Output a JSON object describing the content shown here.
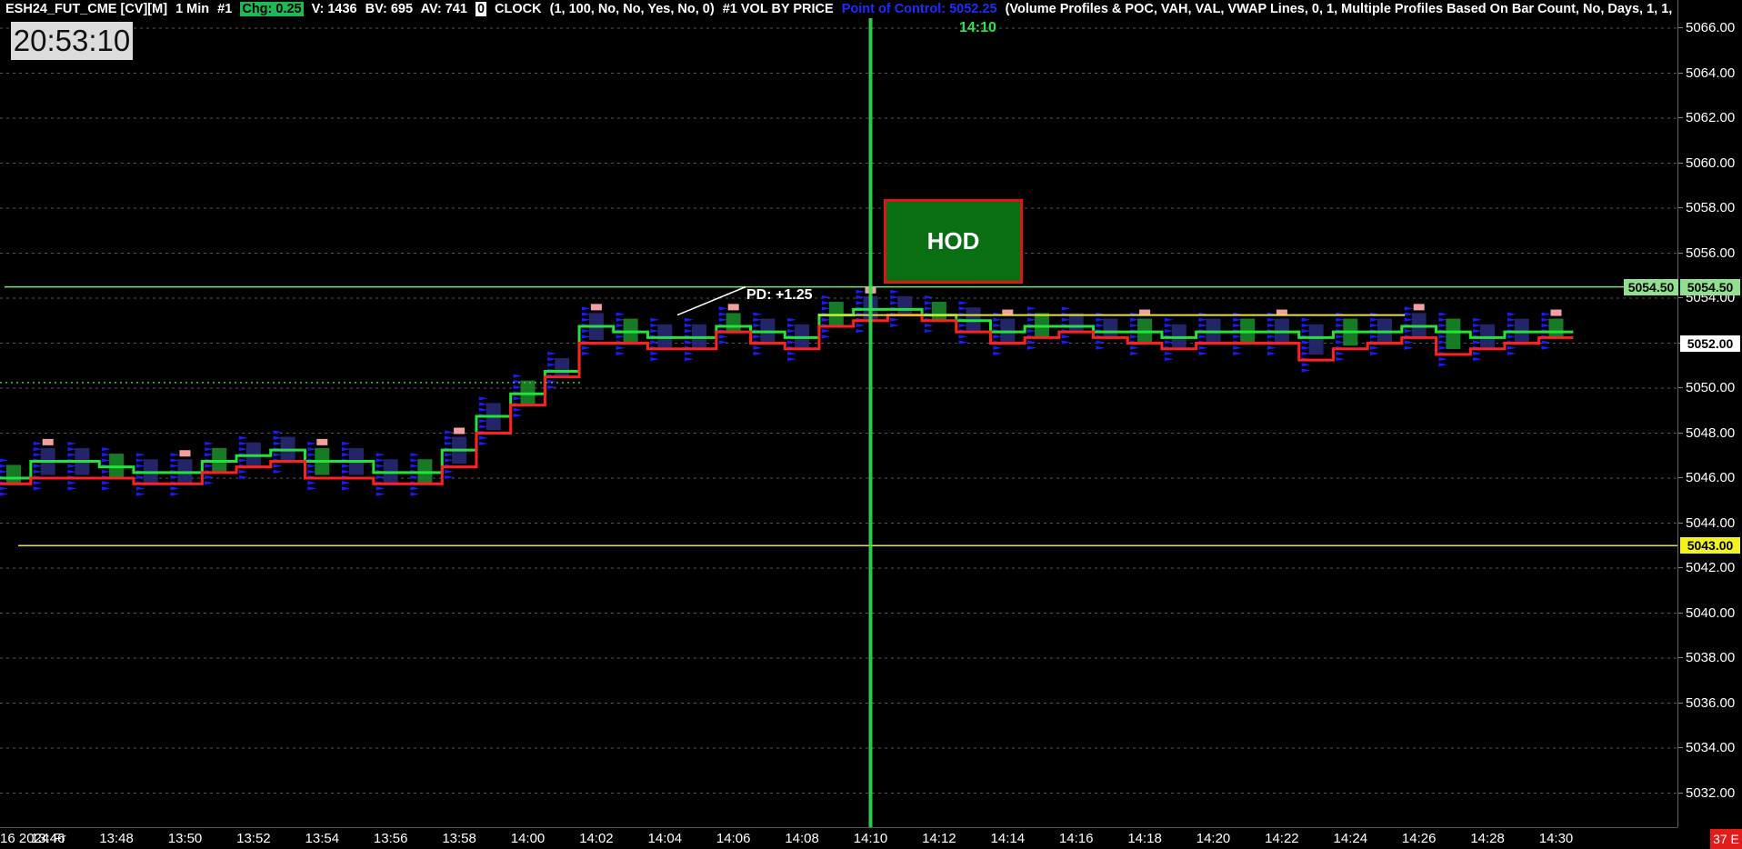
{
  "header": {
    "symbol": "ESH24_FUT_CME [CV][M]",
    "interval": "1 Min",
    "chart_number": "#1",
    "change": "Chg: 0.25",
    "volume": "V: 1436",
    "bid_volume": "BV: 695",
    "ask_volume": "AV: 741",
    "zero_box": "0",
    "clock_study": "CLOCK",
    "clock_params": "(1, 100, No, No, Yes, No, 0)",
    "vbp_study": "#1 VOL BY PRICE",
    "point_of_control": "Point of Control: 5052.25",
    "vbp_params": "(Volume Profiles & POC, VAH, VAL, VWAP Lines, 0, 1, Multiple Profiles Based On Bar Count, No, Days, 1, 1,"
  },
  "clock": "20:53:10",
  "annotations": {
    "hod": "HOD",
    "pd": "PD: +1.25",
    "time_cursor": "14:10"
  },
  "price_axis": {
    "ticks": [
      "5066.00",
      "5064.00",
      "5062.00",
      "5060.00",
      "5058.00",
      "5056.00",
      "5054.00",
      "5052.00",
      "5050.00",
      "5048.00",
      "5046.00",
      "5044.00",
      "5042.00",
      "5040.00",
      "5038.00",
      "5036.00",
      "5034.00",
      "5032.00"
    ],
    "marker_high": "5054.50",
    "marker_current": "5052.00",
    "marker_low": "5043.00"
  },
  "time_axis": {
    "date_label": "16 2024 Fr",
    "ticks": [
      "13:46",
      "13:48",
      "13:50",
      "13:52",
      "13:54",
      "13:56",
      "13:58",
      "14:00",
      "14:02",
      "14:04",
      "14:06",
      "14:08",
      "14:10",
      "14:12",
      "14:14",
      "14:16",
      "14:18",
      "14:20",
      "14:22",
      "14:24",
      "14:26",
      "14:28",
      "14:30"
    ]
  },
  "status_badge": "37 E",
  "colors": {
    "background": "#000000",
    "up": "#22e33a",
    "down": "#ff2020",
    "volume_profile": "#1a1aff",
    "level_line": "#e6e62a",
    "hod_fill": "#0a6e12"
  },
  "chart_data": {
    "type": "line",
    "x": [
      "13:45",
      "13:46",
      "13:47",
      "13:48",
      "13:49",
      "13:50",
      "13:51",
      "13:52",
      "13:53",
      "13:54",
      "13:55",
      "13:56",
      "13:57",
      "13:58",
      "13:59",
      "14:00",
      "14:01",
      "14:02",
      "14:03",
      "14:04",
      "14:05",
      "14:06",
      "14:07",
      "14:08",
      "14:09",
      "14:10",
      "14:11",
      "14:12",
      "14:13",
      "14:14",
      "14:15",
      "14:16",
      "14:17",
      "14:18",
      "14:19",
      "14:20",
      "14:21",
      "14:22",
      "14:23",
      "14:24",
      "14:25",
      "14:26",
      "14:27",
      "14:28",
      "14:29",
      "14:30"
    ],
    "series": [
      {
        "values": [
          5046.0,
          5046.75,
          5046.75,
          5046.5,
          5046.25,
          5046.25,
          5046.75,
          5047.0,
          5047.25,
          5046.75,
          5046.75,
          5046.25,
          5046.25,
          5047.25,
          5048.75,
          5049.75,
          5050.75,
          5052.75,
          5052.5,
          5052.25,
          5052.25,
          5052.75,
          5052.5,
          5052.25,
          5053.25,
          5053.5,
          5053.5,
          5053.25,
          5053.0,
          5052.5,
          5052.75,
          5052.75,
          5052.5,
          5052.5,
          5052.25,
          5052.5,
          5052.5,
          5052.5,
          5052.25,
          5052.5,
          5052.5,
          5052.75,
          5052.5,
          5052.25,
          5052.5,
          5052.5
        ]
      },
      {
        "values": [
          5045.75,
          5046.0,
          5046.0,
          5046.0,
          5045.75,
          5045.75,
          5046.25,
          5046.5,
          5046.75,
          5046.0,
          5046.0,
          5045.75,
          5045.75,
          5046.5,
          5048.0,
          5049.25,
          5050.5,
          5052.0,
          5052.0,
          5051.75,
          5051.75,
          5052.5,
          5052.0,
          5051.75,
          5052.75,
          5053.0,
          5053.25,
          5053.0,
          5052.5,
          5052.0,
          5052.25,
          5052.5,
          5052.25,
          5052.0,
          5051.75,
          5052.0,
          5052.0,
          5052.0,
          5051.25,
          5051.75,
          5052.0,
          5052.25,
          5051.5,
          5051.75,
          5052.0,
          5052.25
        ]
      }
    ],
    "ylim": [
      5031,
      5067
    ],
    "levels": [
      5054.5,
      5052.0,
      5043.0,
      5053.25
    ]
  }
}
